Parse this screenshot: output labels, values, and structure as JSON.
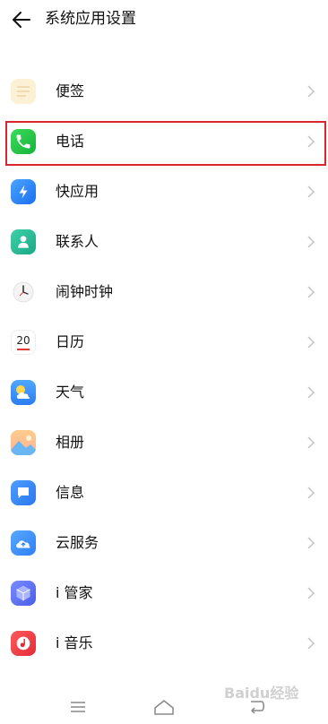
{
  "header": {
    "title": "系统应用设置",
    "back_icon": "arrow-left-icon"
  },
  "items": [
    {
      "label": "便签",
      "icon": "notes-icon",
      "highlighted": false
    },
    {
      "label": "电话",
      "icon": "phone-icon",
      "highlighted": true
    },
    {
      "label": "快应用",
      "icon": "quick-app-icon",
      "highlighted": false
    },
    {
      "label": "联系人",
      "icon": "contacts-icon",
      "highlighted": false
    },
    {
      "label": "闹钟时钟",
      "icon": "clock-icon",
      "highlighted": false
    },
    {
      "label": "日历",
      "icon": "calendar-icon",
      "highlighted": false,
      "icon_text": "20"
    },
    {
      "label": "天气",
      "icon": "weather-icon",
      "highlighted": false
    },
    {
      "label": "相册",
      "icon": "gallery-icon",
      "highlighted": false
    },
    {
      "label": "信息",
      "icon": "messages-icon",
      "highlighted": false
    },
    {
      "label": "云服务",
      "icon": "cloud-service-icon",
      "highlighted": false
    },
    {
      "label": "i 管家",
      "icon": "i-manager-icon",
      "highlighted": false
    },
    {
      "label": "i 音乐",
      "icon": "i-music-icon",
      "highlighted": false
    }
  ],
  "colors": {
    "highlight_border": "#d9262c",
    "chevron": "#c4c4c4"
  },
  "navbar": {
    "menu_icon": "menu-icon",
    "home_icon": "home-icon",
    "back_icon": "back-nav-icon"
  },
  "watermark": "Baidu经验"
}
